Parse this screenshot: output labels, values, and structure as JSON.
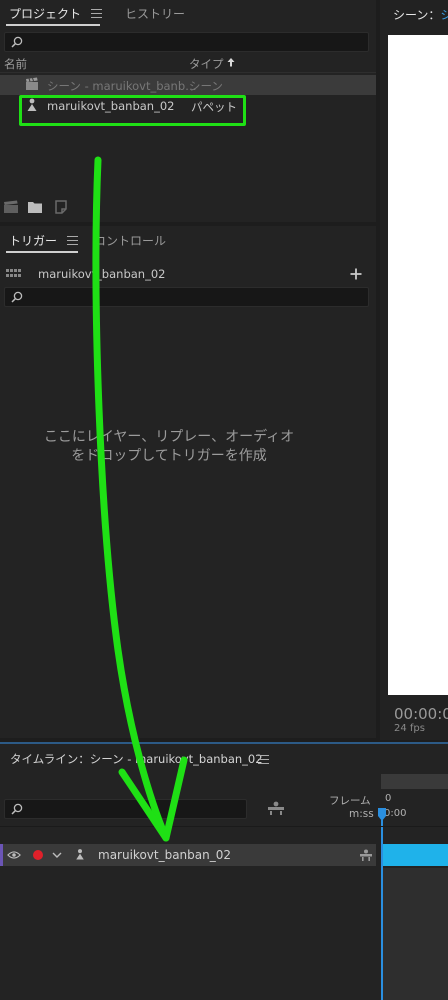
{
  "project_panel": {
    "tabs": [
      {
        "label": "プロジェクト",
        "active": true
      },
      {
        "label": "ヒストリー",
        "active": false
      }
    ],
    "search_placeholder": "",
    "columns": {
      "name": "名前",
      "type": "タイプ",
      "sort_icon": "sort-up-arrow-icon"
    },
    "items": [
      {
        "name": "シーン - maruikovt_banb…",
        "type": "シーン",
        "icon": "scene-clapboard-icon",
        "selected": false
      },
      {
        "name": "maruikovt_banban_02",
        "type": "パペット",
        "icon": "puppet-icon",
        "selected": true,
        "highlight_color": "#1fe015"
      }
    ],
    "footer_icons": [
      "new-scene-icon",
      "folder-icon",
      "new-item-icon"
    ]
  },
  "triggers_panel": {
    "tabs": [
      {
        "label": "トリガー",
        "active": true
      },
      {
        "label": "コントロール",
        "active": false
      }
    ],
    "puppet_name": "maruikovt_banban_02",
    "keyboard_icon": "keyboard-icon",
    "add_icon": "plus-icon",
    "search_placeholder": "",
    "drop_hint_line1": "ここにレイヤー、リプレー、オーディオ",
    "drop_hint_line2": "をドロップしてトリガーを作成"
  },
  "scene_panel": {
    "tab_label_prefix": "シーン：",
    "tab_label_suffix": "シ",
    "timecode": "00:00:0",
    "fps": "24 fps"
  },
  "timeline_panel": {
    "title": "タイムライン：シーン - maruikovt_banban_02",
    "search_placeholder": "",
    "frames_label": "フレーム",
    "time_label": "m:ss",
    "ruler_frame": "0",
    "ruler_time": "0:00",
    "track_name": "maruikovt_banban_02",
    "record_color": "#e0202a",
    "accent_color": "#1fb2ea"
  },
  "annotation": {
    "arrow_color": "#1fe015"
  }
}
